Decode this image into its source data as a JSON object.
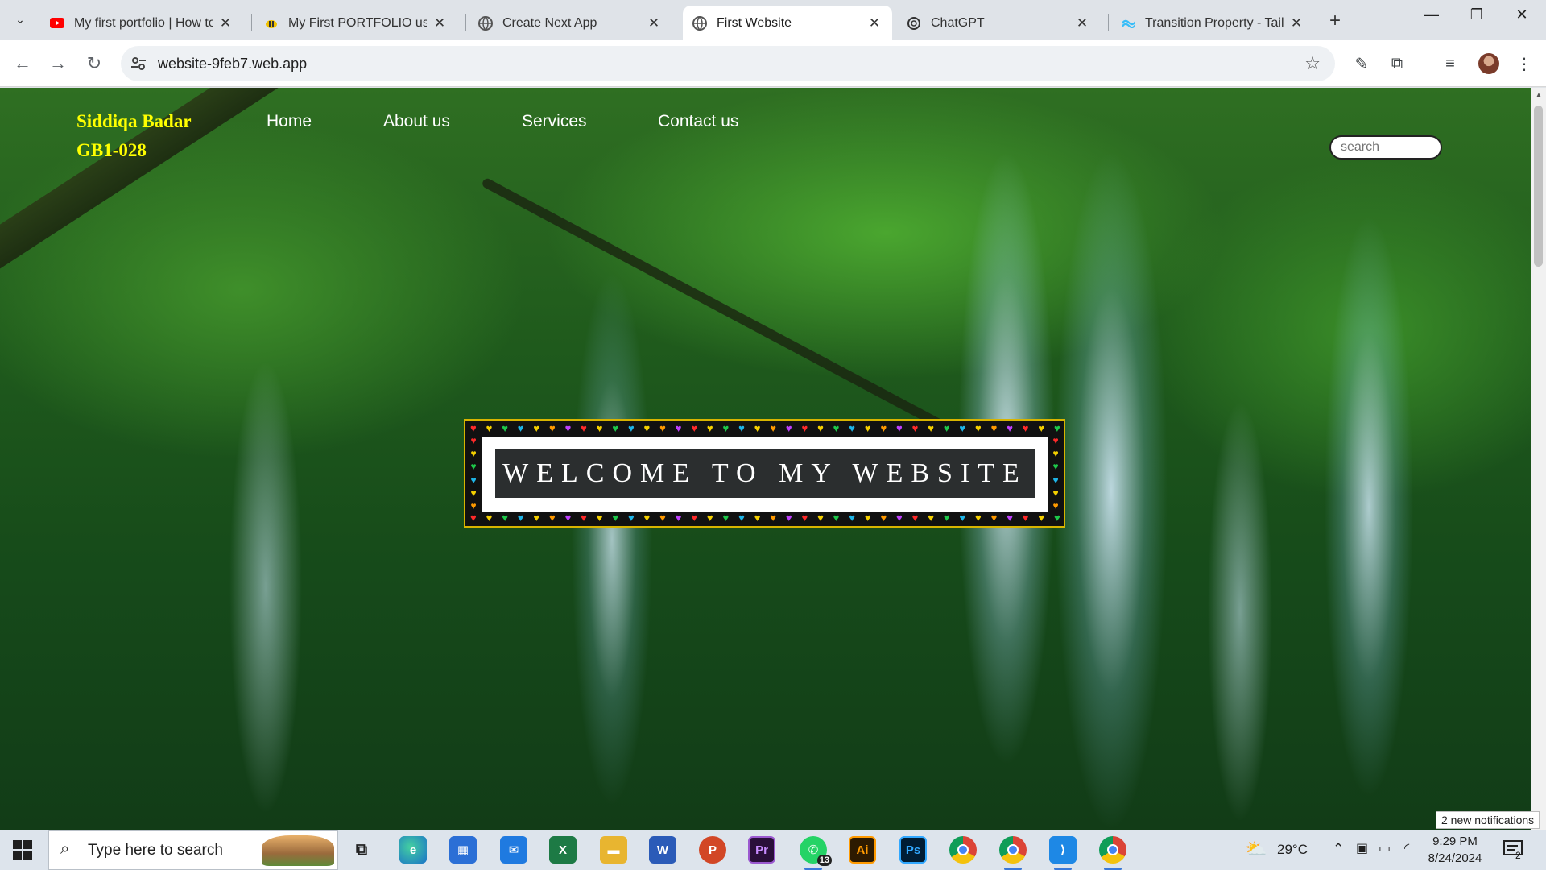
{
  "browser": {
    "tabs": [
      {
        "title": "My first portfolio | How to",
        "favicon": "youtube-icon",
        "active": false
      },
      {
        "title": "My First PORTFOLIO using",
        "favicon": "bee-icon",
        "active": false
      },
      {
        "title": "Create Next App",
        "favicon": "globe-icon",
        "active": false
      },
      {
        "title": "First Website",
        "favicon": "globe-icon",
        "active": true
      },
      {
        "title": "ChatGPT",
        "favicon": "chatgpt-icon",
        "active": false
      },
      {
        "title": "Transition Property - Tailw",
        "favicon": "tailwind-icon",
        "active": false
      }
    ],
    "url": "website-9feb7.web.app"
  },
  "page": {
    "brand_line1": "Siddiqa Badar",
    "brand_line2": "GB1-028",
    "nav": [
      "Home",
      "About us",
      "Services",
      "Contact us"
    ],
    "search_placeholder": "search",
    "welcome": "WELCOME TO MY WEBSITE",
    "colors": {
      "brand": "#ffff00",
      "frame": "#111111",
      "banner": "#2b2e2f"
    }
  },
  "notification_toast": "2 new notifications",
  "taskbar": {
    "search_placeholder": "Type here to search",
    "apps": [
      "task-view",
      "edge",
      "store",
      "mail",
      "excel",
      "file-explorer",
      "word",
      "powerpoint",
      "premiere",
      "whatsapp",
      "illustrator",
      "photoshop",
      "chrome",
      "chrome-profile",
      "vscode",
      "chrome-2"
    ],
    "whatsapp_badge": "13",
    "weather": "29°C",
    "time": "9:29 PM",
    "date": "8/24/2024",
    "notification_count": "2"
  }
}
